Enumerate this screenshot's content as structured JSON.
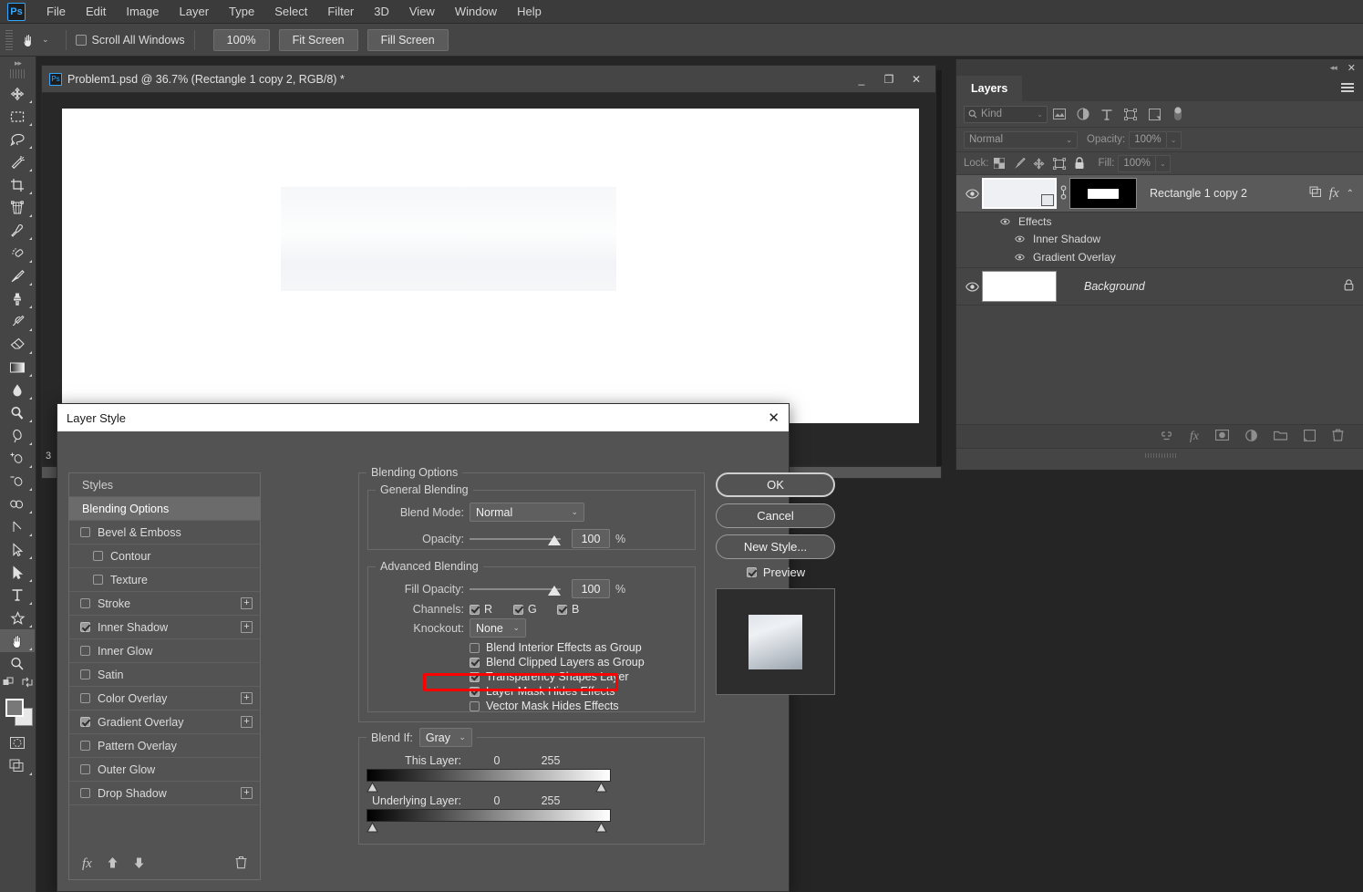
{
  "app": {
    "logo": "Ps",
    "menus": [
      "File",
      "Edit",
      "Image",
      "Layer",
      "Type",
      "Select",
      "Filter",
      "3D",
      "View",
      "Window",
      "Help"
    ]
  },
  "options_bar": {
    "tool_icon": "hand-tool-icon",
    "scroll_all_windows_label": "Scroll All Windows",
    "scroll_all_windows_checked": false,
    "buttons": [
      "100%",
      "Fit Screen",
      "Fill Screen"
    ]
  },
  "toolbar": {
    "tools": [
      {
        "name": "move-tool",
        "active": false
      },
      {
        "name": "rectangular-marquee-tool",
        "active": false
      },
      {
        "name": "lasso-tool",
        "active": false
      },
      {
        "name": "magic-wand-tool",
        "active": false
      },
      {
        "name": "crop-tool",
        "active": false
      },
      {
        "name": "perspective-crop-tool",
        "active": false
      },
      {
        "name": "eyedropper-tool",
        "active": false
      },
      {
        "name": "spot-healing-brush-tool",
        "active": false
      },
      {
        "name": "brush-tool",
        "active": false
      },
      {
        "name": "clone-stamp-tool",
        "active": false
      },
      {
        "name": "history-brush-tool",
        "active": false
      },
      {
        "name": "eraser-tool",
        "active": false
      },
      {
        "name": "gradient-tool",
        "active": false
      },
      {
        "name": "blur-tool",
        "active": false
      },
      {
        "name": "dodge-tool",
        "active": false
      },
      {
        "name": "pen-tool",
        "active": false
      },
      {
        "name": "add-anchor-point-tool",
        "active": false
      },
      {
        "name": "delete-anchor-point-tool",
        "active": false
      },
      {
        "name": "convert-point-tool",
        "active": false
      },
      {
        "name": "line-tool",
        "active": false
      },
      {
        "name": "path-selection-tool",
        "active": false
      },
      {
        "name": "direct-selection-tool",
        "active": false
      },
      {
        "name": "horizontal-type-tool",
        "active": false
      },
      {
        "name": "custom-shape-tool",
        "active": false
      },
      {
        "name": "hand-tool",
        "active": true
      },
      {
        "name": "zoom-tool",
        "active": false
      }
    ],
    "foreground_color": "#787878",
    "background_color": "#e8e8e8"
  },
  "document": {
    "title": "Problem1.psd @ 36.7% (Rectangle 1 copy 2, RGB/8) *",
    "window_buttons": [
      "minimize",
      "maximize",
      "close"
    ],
    "status_zoom": "3"
  },
  "layers_panel": {
    "tab_label": "Layers",
    "filter": {
      "kind_label": "Kind",
      "icons": [
        "pixel-filter-icon",
        "adjustment-filter-icon",
        "type-filter-icon",
        "shape-filter-icon",
        "smart-object-filter-icon",
        "filter-toggle-icon"
      ]
    },
    "blend_mode": "Normal",
    "opacity_label": "Opacity:",
    "opacity_value": "100%",
    "lock_label": "Lock:",
    "fill_label": "Fill:",
    "fill_value": "100%",
    "lock_icons": [
      "lock-transparent-pixels-icon",
      "lock-image-pixels-icon",
      "lock-position-icon",
      "lock-artboard-icon",
      "lock-all-icon"
    ],
    "layers": [
      {
        "name": "Rectangle 1 copy 2",
        "visible": true,
        "selected": true,
        "has_mask": true,
        "fx_label": "fx",
        "effects_label": "Effects",
        "effects": [
          "Inner Shadow",
          "Gradient Overlay"
        ]
      },
      {
        "name": "Background",
        "visible": true,
        "selected": false,
        "locked": true,
        "italic": true
      }
    ],
    "bottom_icons": [
      "link-layers-icon",
      "add-layer-style-icon",
      "add-layer-mask-icon",
      "new-adjustment-layer-icon",
      "new-group-icon",
      "new-layer-icon",
      "delete-layer-icon"
    ],
    "bottom_fx_label": "fx"
  },
  "layer_style_dialog": {
    "title": "Layer Style",
    "close_label": "✕",
    "styles_list_header": "Styles",
    "styles": [
      {
        "label": "Blending Options",
        "selected": true,
        "checkbox": false,
        "indent": false,
        "plus": false
      },
      {
        "label": "Bevel & Emboss",
        "checked": false,
        "checkbox": true,
        "indent": false,
        "plus": false
      },
      {
        "label": "Contour",
        "checked": false,
        "checkbox": true,
        "indent": true,
        "plus": false
      },
      {
        "label": "Texture",
        "checked": false,
        "checkbox": true,
        "indent": true,
        "plus": false
      },
      {
        "label": "Stroke",
        "checked": false,
        "checkbox": true,
        "indent": false,
        "plus": true
      },
      {
        "label": "Inner Shadow",
        "checked": true,
        "checkbox": true,
        "indent": false,
        "plus": true
      },
      {
        "label": "Inner Glow",
        "checked": false,
        "checkbox": true,
        "indent": false,
        "plus": false
      },
      {
        "label": "Satin",
        "checked": false,
        "checkbox": true,
        "indent": false,
        "plus": false
      },
      {
        "label": "Color Overlay",
        "checked": false,
        "checkbox": true,
        "indent": false,
        "plus": true
      },
      {
        "label": "Gradient Overlay",
        "checked": true,
        "checkbox": true,
        "indent": false,
        "plus": true
      },
      {
        "label": "Pattern Overlay",
        "checked": false,
        "checkbox": true,
        "indent": false,
        "plus": false
      },
      {
        "label": "Outer Glow",
        "checked": false,
        "checkbox": true,
        "indent": false,
        "plus": false
      },
      {
        "label": "Drop Shadow",
        "checked": false,
        "checkbox": true,
        "indent": false,
        "plus": true
      }
    ],
    "styles_footer_icons": [
      "fx-icon",
      "move-up-icon",
      "move-down-icon",
      "delete-effect-icon"
    ],
    "styles_footer_fx": "fx",
    "blending_options_title": "Blending Options",
    "general_blending": {
      "section_label": "General Blending",
      "blend_mode_label": "Blend Mode:",
      "blend_mode_value": "Normal",
      "opacity_label": "Opacity:",
      "opacity_value": "100",
      "opacity_pct": "%"
    },
    "advanced_blending": {
      "section_label": "Advanced Blending",
      "fill_opacity_label": "Fill Opacity:",
      "fill_opacity_value": "100",
      "fill_opacity_pct": "%",
      "channels_label": "Channels:",
      "channels": [
        {
          "label": "R",
          "checked": true
        },
        {
          "label": "G",
          "checked": true
        },
        {
          "label": "B",
          "checked": true
        }
      ],
      "knockout_label": "Knockout:",
      "knockout_value": "None",
      "options": [
        {
          "label": "Blend Interior Effects as Group",
          "checked": false,
          "highlighted": false
        },
        {
          "label": "Blend Clipped Layers as Group",
          "checked": true,
          "highlighted": false
        },
        {
          "label": "Transparency Shapes Layer",
          "checked": true,
          "highlighted": false
        },
        {
          "label": "Layer Mask Hides Effects",
          "checked": true,
          "highlighted": true
        },
        {
          "label": "Vector Mask Hides Effects",
          "checked": false,
          "highlighted": false
        }
      ],
      "highlight_color": "#ff0000"
    },
    "blend_if": {
      "label": "Blend If:",
      "channel_value": "Gray",
      "this_layer_label": "This Layer:",
      "this_layer_min": "0",
      "this_layer_max": "255",
      "underlying_layer_label": "Underlying Layer:",
      "underlying_layer_min": "0",
      "underlying_layer_max": "255"
    },
    "buttons": {
      "ok": "OK",
      "cancel": "Cancel",
      "new_style": "New Style...",
      "preview_label": "Preview",
      "preview_checked": true
    }
  }
}
